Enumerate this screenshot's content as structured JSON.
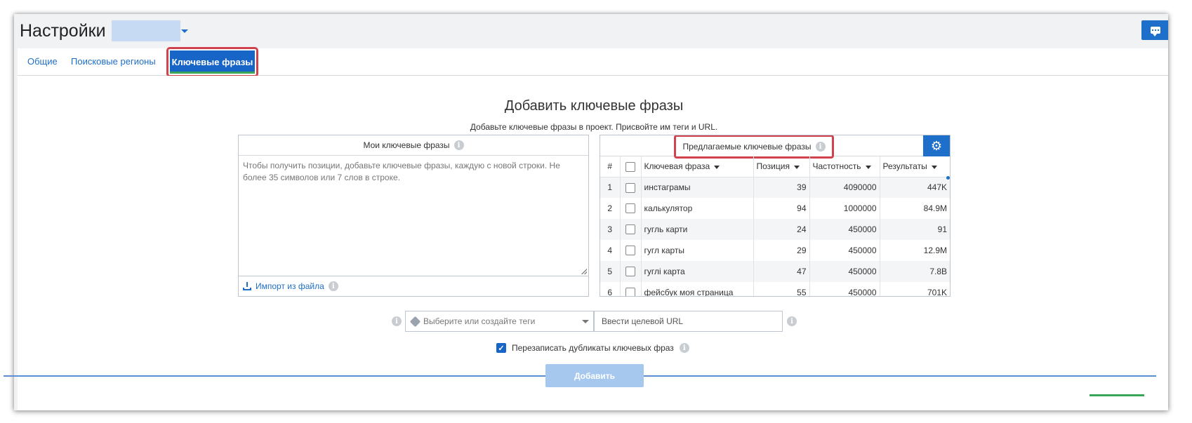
{
  "header": {
    "title": "Настройки"
  },
  "tabs": [
    {
      "label": "Общие"
    },
    {
      "label": "Поисковые регионы"
    },
    {
      "label": "Ключевые фразы"
    }
  ],
  "main": {
    "heading": "Добавить ключевые фразы",
    "subheading": "Добавьте ключевые фразы в проект. Присвойте им теги и URL."
  },
  "my_keywords": {
    "title": "Мои ключевые фразы",
    "placeholder": "Чтобы получить позиции, добавьте ключевые фразы, каждую с новой строки. Не более 35 символов или 7 слов в строке.",
    "import_label": "Импорт из файла"
  },
  "suggested": {
    "title": "Предлагаемые ключевые фразы",
    "columns": [
      "#",
      "Ключевая фраза",
      "Позиция",
      "Частотность",
      "Результаты"
    ],
    "rows": [
      {
        "n": "1",
        "phrase": "инстаграмы",
        "position": "39",
        "frequency": "4090000",
        "results": "447K"
      },
      {
        "n": "2",
        "phrase": "калькулятор",
        "position": "94",
        "frequency": "1000000",
        "results": "84.9M"
      },
      {
        "n": "3",
        "phrase": "гугль карти",
        "position": "24",
        "frequency": "450000",
        "results": "91"
      },
      {
        "n": "4",
        "phrase": "гугл карты",
        "position": "29",
        "frequency": "450000",
        "results": "12.9M"
      },
      {
        "n": "5",
        "phrase": "гуглі карта",
        "position": "47",
        "frequency": "450000",
        "results": "7.8B"
      },
      {
        "n": "6",
        "phrase": "фейсбук моя страница",
        "position": "55",
        "frequency": "450000",
        "results": "701K"
      }
    ]
  },
  "form": {
    "tags_placeholder": "Выберите или создайте теги",
    "url_placeholder": "Ввести целевой URL",
    "overwrite_label": "Перезаписать дубликаты ключевых фраз",
    "add_button": "Добавить"
  },
  "icons": {
    "info": "i",
    "gear": "⚙",
    "check": "✓"
  },
  "colors": {
    "accent": "#1e6fc9",
    "highlight": "#d0424d",
    "link": "#1f6fc6"
  }
}
